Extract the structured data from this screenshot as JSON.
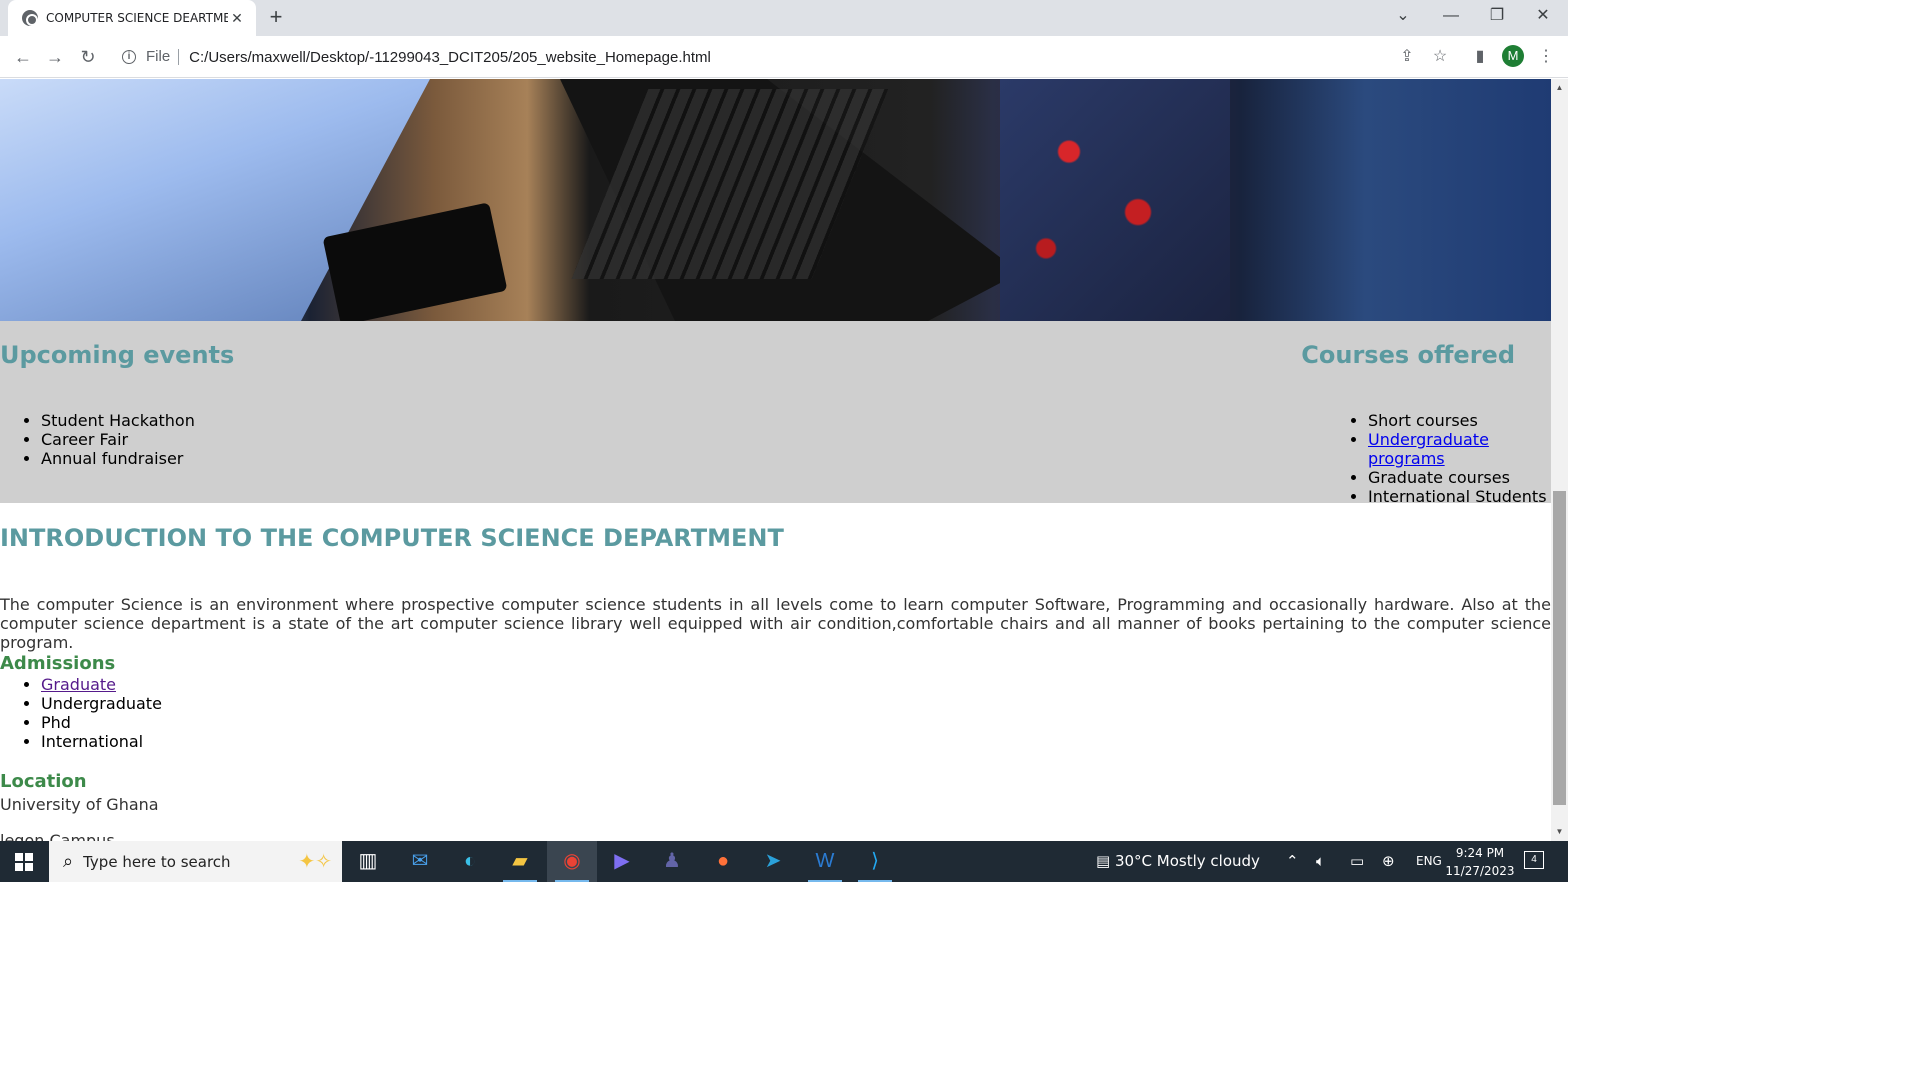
{
  "browser": {
    "tab_title": "COMPUTER SCIENCE DEARTMENT",
    "tab_close": "✕",
    "new_tab": "+",
    "url_scheme": "File",
    "url": "C:/Users/maxwell/Desktop/-11299043_DCIT205/205_website_Homepage.html",
    "profile_initial": "M"
  },
  "page": {
    "events": {
      "title": "Upcoming events",
      "items": [
        "Student Hackathon",
        "Career Fair",
        "Annual fundraiser"
      ]
    },
    "courses": {
      "title": "Courses offered",
      "items": [
        "Short courses",
        "Undergraduate programs",
        "Graduate courses",
        "International Students"
      ]
    },
    "intro": {
      "title": "INTRODUCTION TO THE COMPUTER SCIENCE DEPARTMENT",
      "paragraph": "The computer Science is an environment where prospective computer science students in all levels come to learn computer Software, Programming and occasionally hardware. Also at the computer science department is a state of the art computer science library well equipped with air condition,comfortable chairs and all manner of books pertaining to the computer science program."
    },
    "admissions": {
      "title": "Admissions",
      "items": [
        "Graduate",
        "Undergraduate",
        "Phd",
        "International"
      ]
    },
    "location": {
      "title": "Location",
      "line1": "University of Ghana",
      "line2": "legon Campus"
    }
  },
  "taskbar": {
    "search_placeholder": "Type here to search",
    "weather": "30°C  Mostly cloudy",
    "language": "ENG",
    "time": "9:24 PM",
    "date": "11/27/2023",
    "notifications": "4"
  },
  "colors": {
    "heading_teal": "#5b9aa0",
    "heading_green": "#3d8a4a",
    "band_gray": "#cfcfcf",
    "link": "#0000ee",
    "visited_link": "#551a8b"
  }
}
